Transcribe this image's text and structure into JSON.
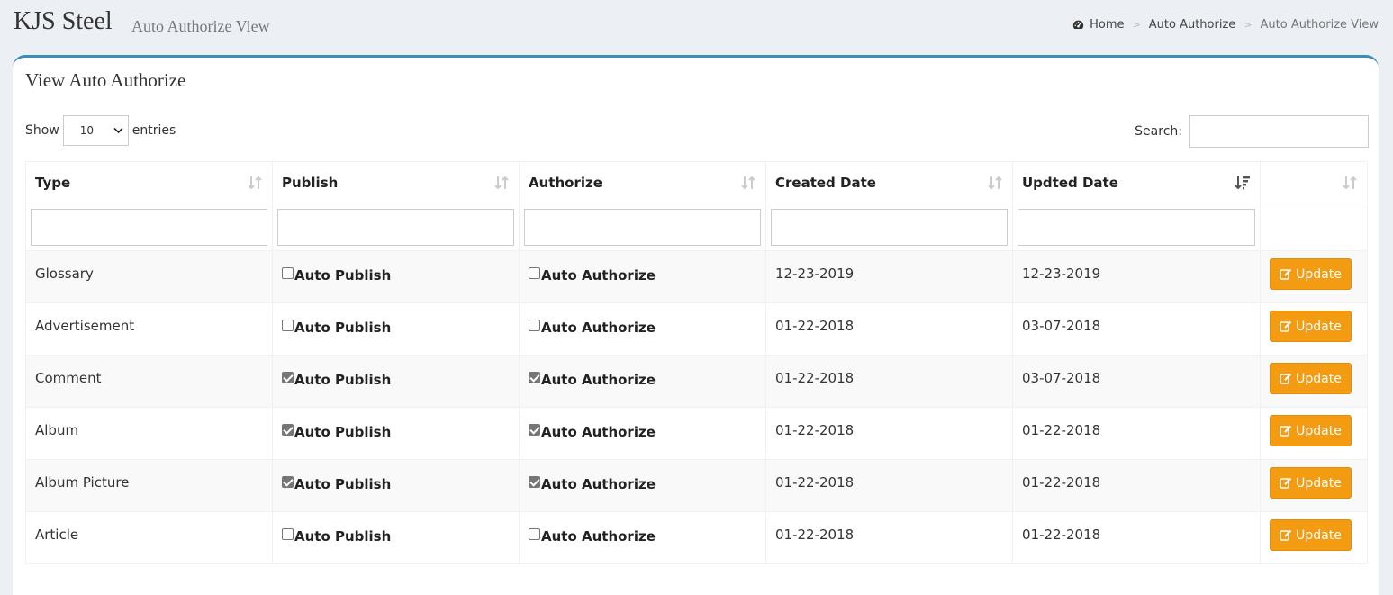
{
  "header": {
    "brand": "KJS Steel",
    "subtitle": "Auto Authorize View",
    "breadcrumb": [
      {
        "label": "Home",
        "icon": "dashboard-icon"
      },
      {
        "label": "Auto Authorize"
      },
      {
        "label": "Auto Authorize View"
      }
    ]
  },
  "box": {
    "title": "View Auto Authorize",
    "length": {
      "show": "Show",
      "value": "10",
      "entries": "entries"
    },
    "search": {
      "label": "Search:",
      "value": ""
    }
  },
  "table": {
    "columns": [
      "Type",
      "Publish",
      "Authorize",
      "Created Date",
      "Updted Date",
      ""
    ],
    "sorted_column": "Updted Date",
    "rows": [
      {
        "type": "Glossary",
        "publish_label": "Auto Publish",
        "publish_checked": false,
        "authorize_label": "Auto Authorize",
        "authorize_checked": false,
        "created": "12-23-2019",
        "updated": "12-23-2019",
        "action": "Update"
      },
      {
        "type": "Advertisement",
        "publish_label": "Auto Publish",
        "publish_checked": false,
        "authorize_label": "Auto Authorize",
        "authorize_checked": false,
        "created": "01-22-2018",
        "updated": "03-07-2018",
        "action": "Update"
      },
      {
        "type": "Comment",
        "publish_label": "Auto Publish",
        "publish_checked": true,
        "authorize_label": "Auto Authorize",
        "authorize_checked": true,
        "created": "01-22-2018",
        "updated": "03-07-2018",
        "action": "Update"
      },
      {
        "type": "Album",
        "publish_label": "Auto Publish",
        "publish_checked": true,
        "authorize_label": "Auto Authorize",
        "authorize_checked": true,
        "created": "01-22-2018",
        "updated": "01-22-2018",
        "action": "Update"
      },
      {
        "type": "Album Picture",
        "publish_label": "Auto Publish",
        "publish_checked": true,
        "authorize_label": "Auto Authorize",
        "authorize_checked": true,
        "created": "01-22-2018",
        "updated": "01-22-2018",
        "action": "Update"
      },
      {
        "type": "Article",
        "publish_label": "Auto Publish",
        "publish_checked": false,
        "authorize_label": "Auto Authorize",
        "authorize_checked": false,
        "created": "01-22-2018",
        "updated": "01-22-2018",
        "action": "Update"
      }
    ]
  },
  "colors": {
    "accent": "#3c8dbc",
    "update_button": "#f39c12",
    "background": "#ecf0f5"
  }
}
